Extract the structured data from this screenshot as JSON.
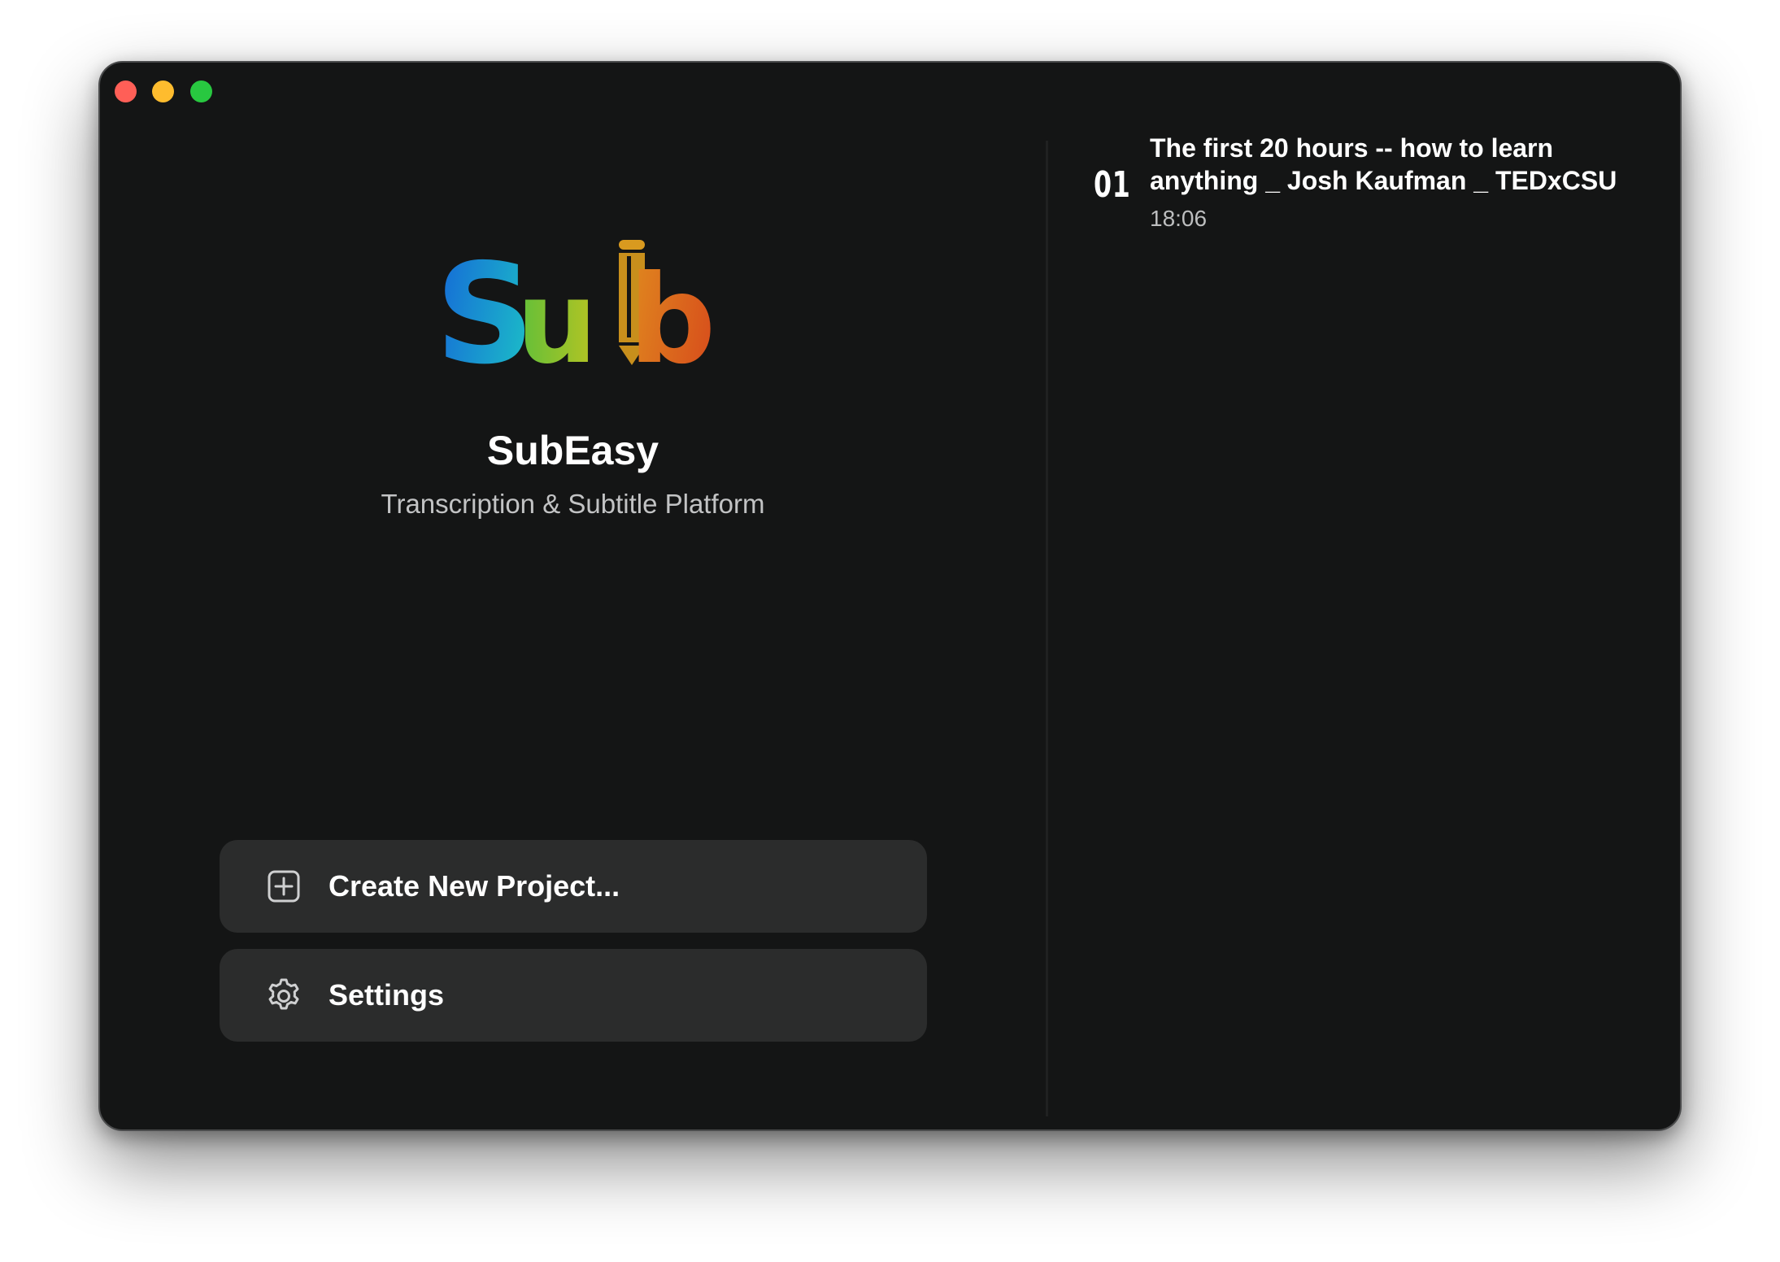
{
  "window": {
    "controls": [
      "close",
      "minimize",
      "maximize"
    ]
  },
  "brand": {
    "logo_text": "Sub",
    "app_name": "SubEasy",
    "tagline": "Transcription & Subtitle Platform"
  },
  "actions": {
    "create_label": "Create New Project...",
    "create_icon": "plus-square-icon",
    "settings_label": "Settings",
    "settings_icon": "gear-icon"
  },
  "recent_projects": [
    {
      "index": "01",
      "title": "The first 20 hours -- how to learn anything _ Josh Kaufman _ TEDxCSU",
      "duration": "18:06"
    }
  ],
  "colors": {
    "window_bg": "#141515",
    "button_bg": "#2b2c2c",
    "close": "#ff5f57",
    "minimize": "#febc2e",
    "maximize": "#28c840",
    "logo_s": "#1aa4d8",
    "logo_u": "#8cc63f",
    "logo_b": "#e8731e",
    "logo_pencil": "#c88f1c"
  }
}
